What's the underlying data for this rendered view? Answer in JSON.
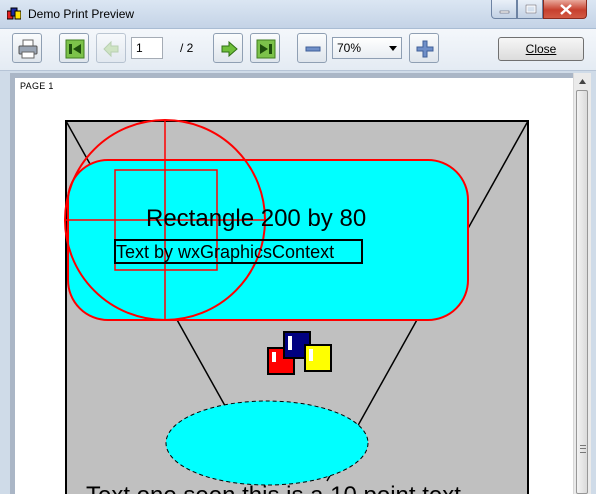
{
  "window": {
    "title": "Demo Print Preview"
  },
  "toolbar": {
    "print_icon": "printer-icon",
    "first_icon": "first-page-icon",
    "prev_icon": "previous-page-icon",
    "page_value": "1",
    "page_total": "/ 2",
    "next_icon": "next-page-icon",
    "last_icon": "last-page-icon",
    "zoom_out_icon": "minus-icon",
    "zoom_value": "70%",
    "zoom_in_icon": "plus-icon",
    "close_label": "Close"
  },
  "page": {
    "label": "PAGE 1",
    "rect_text": "Rectangle 200 by 80",
    "gc_text": "Text by wxGraphicsContext",
    "bottom_text": "Text one seen this is a 10 point text"
  },
  "colors": {
    "cyan": "#00ffff",
    "gray": "#c0c0c0",
    "red": "#ff0000",
    "navy": "#000080",
    "yellow": "#ffff00"
  }
}
